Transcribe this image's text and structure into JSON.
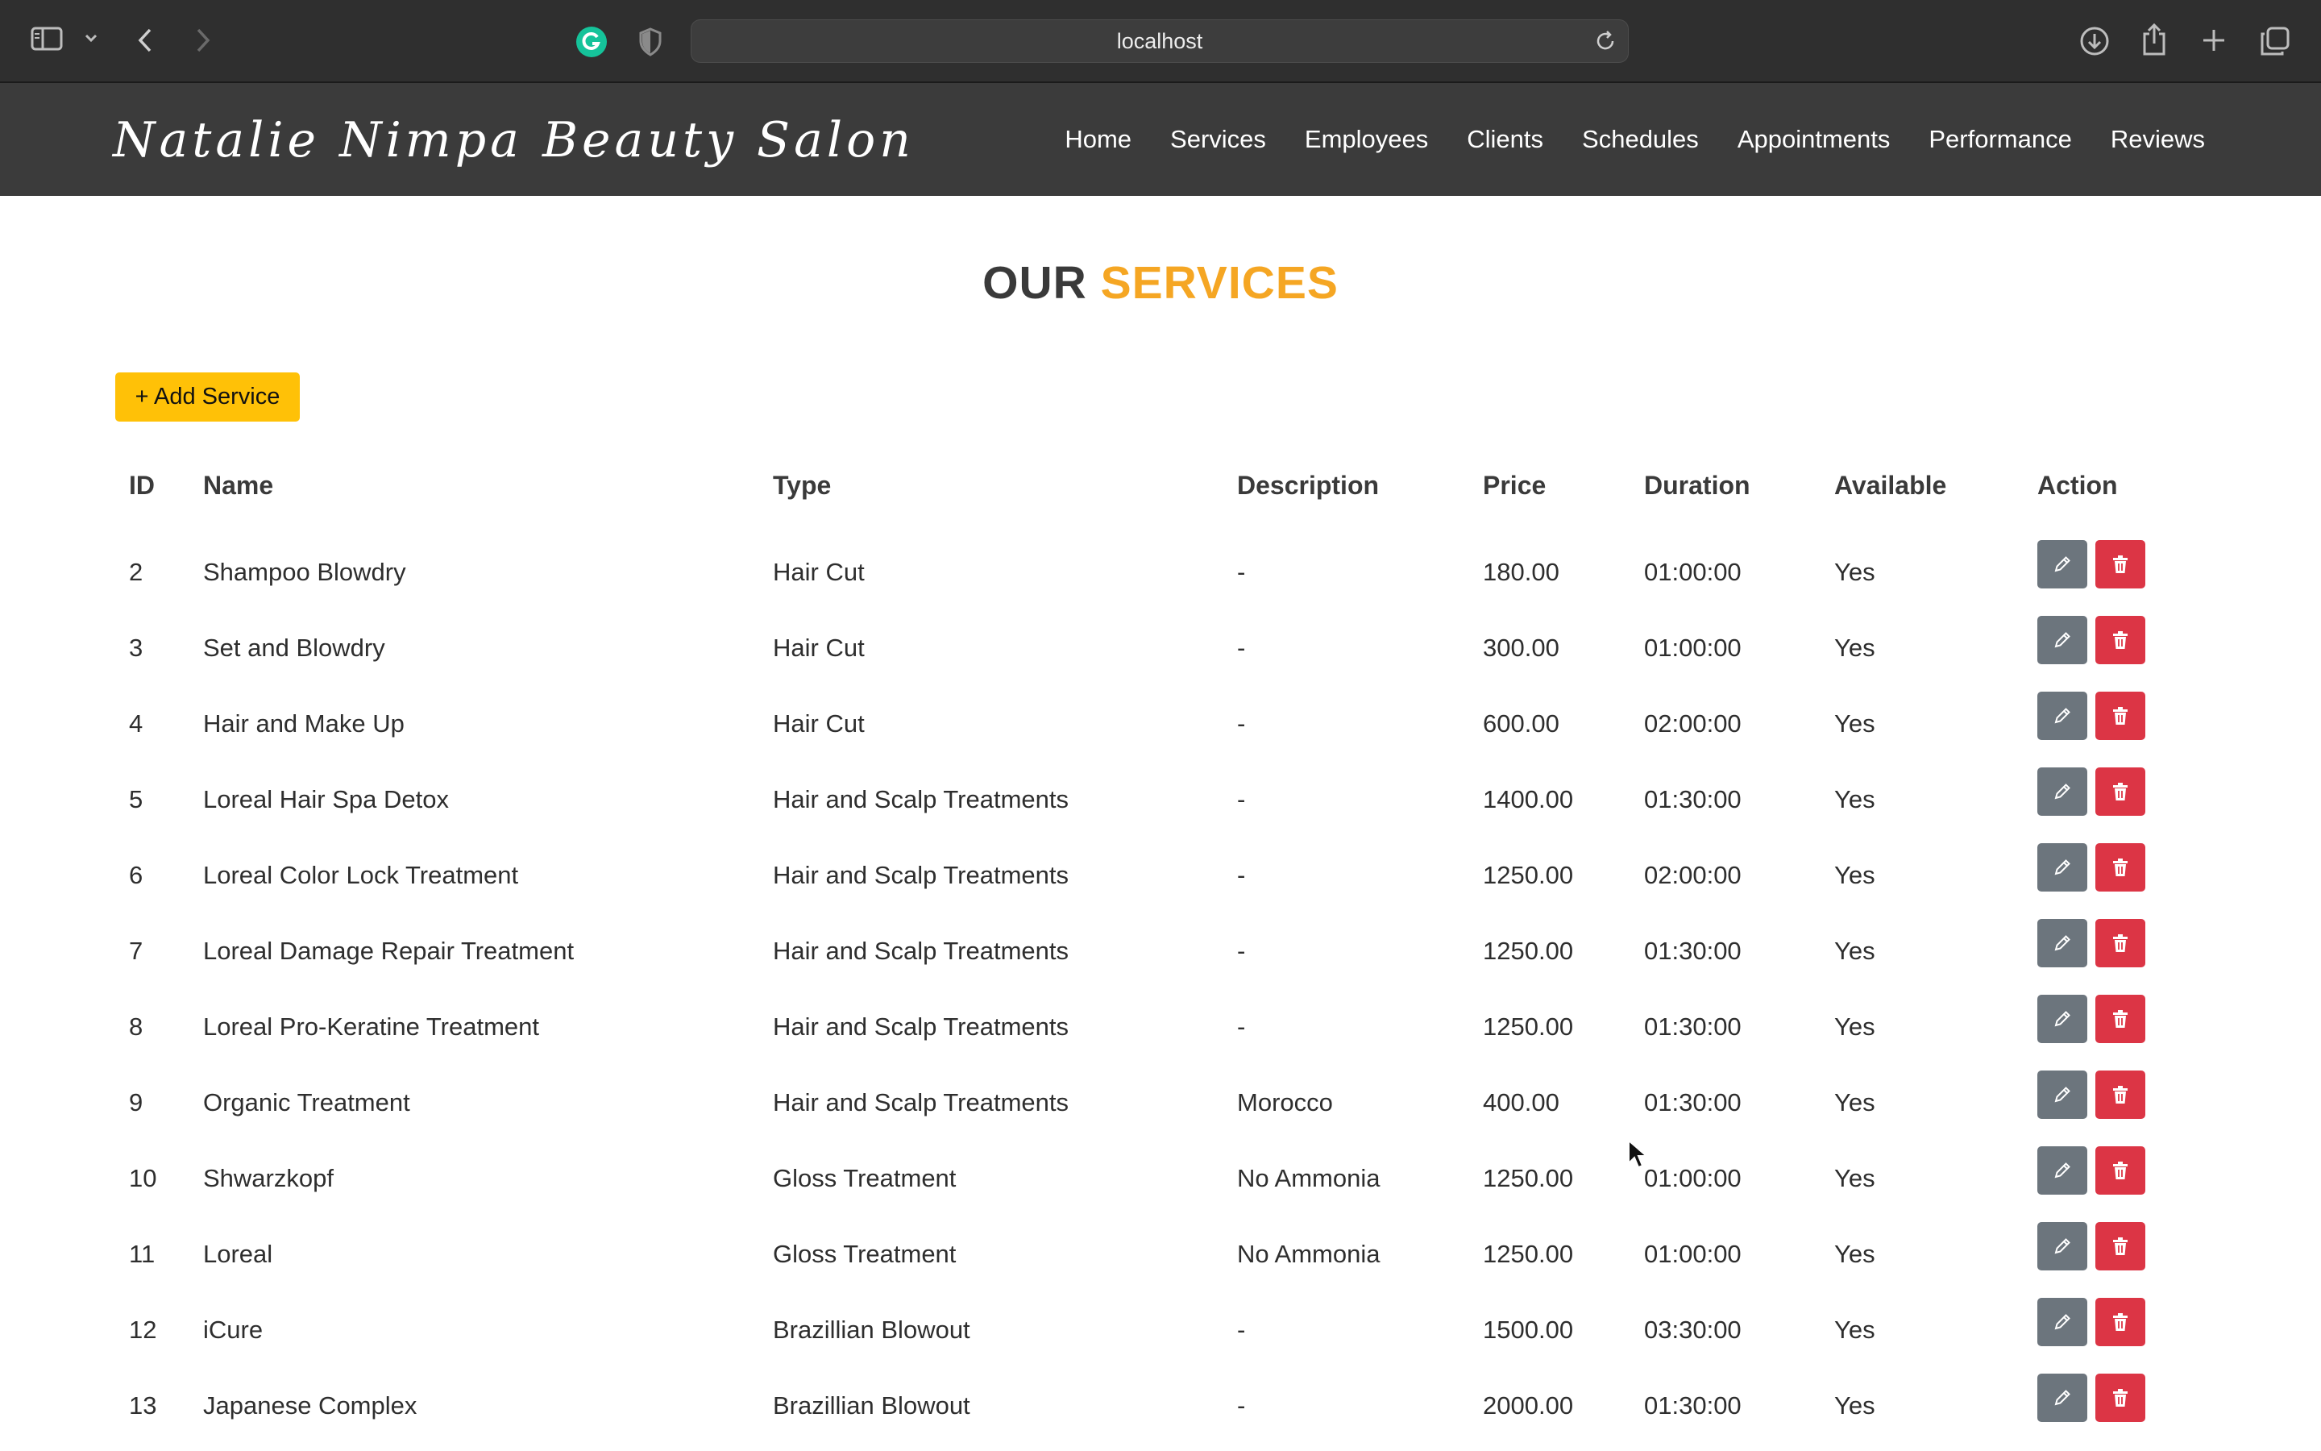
{
  "browser": {
    "url": "localhost"
  },
  "site": {
    "brand": "Natalie Nimpa Beauty Salon",
    "nav": [
      "Home",
      "Services",
      "Employees",
      "Clients",
      "Schedules",
      "Appointments",
      "Performance",
      "Reviews"
    ]
  },
  "page": {
    "heading_part1": "OUR",
    "heading_part2": "SERVICES",
    "add_button": "+ Add Service"
  },
  "table": {
    "headers": {
      "id": "ID",
      "name": "Name",
      "type": "Type",
      "description": "Description",
      "price": "Price",
      "duration": "Duration",
      "available": "Available",
      "action": "Action"
    },
    "rows": [
      {
        "id": "2",
        "name": "Shampoo Blowdry",
        "type": "Hair Cut",
        "description": "-",
        "price": "180.00",
        "duration": "01:00:00",
        "available": "Yes"
      },
      {
        "id": "3",
        "name": "Set and Blowdry",
        "type": "Hair Cut",
        "description": "-",
        "price": "300.00",
        "duration": "01:00:00",
        "available": "Yes"
      },
      {
        "id": "4",
        "name": "Hair and Make Up",
        "type": "Hair Cut",
        "description": "-",
        "price": "600.00",
        "duration": "02:00:00",
        "available": "Yes"
      },
      {
        "id": "5",
        "name": "Loreal Hair Spa Detox",
        "type": "Hair and Scalp Treatments",
        "description": "-",
        "price": "1400.00",
        "duration": "01:30:00",
        "available": "Yes"
      },
      {
        "id": "6",
        "name": "Loreal Color Lock Treatment",
        "type": "Hair and Scalp Treatments",
        "description": "-",
        "price": "1250.00",
        "duration": "02:00:00",
        "available": "Yes"
      },
      {
        "id": "7",
        "name": "Loreal Damage Repair Treatment",
        "type": "Hair and Scalp Treatments",
        "description": "-",
        "price": "1250.00",
        "duration": "01:30:00",
        "available": "Yes"
      },
      {
        "id": "8",
        "name": "Loreal Pro-Keratine Treatment",
        "type": "Hair and Scalp Treatments",
        "description": "-",
        "price": "1250.00",
        "duration": "01:30:00",
        "available": "Yes"
      },
      {
        "id": "9",
        "name": "Organic Treatment",
        "type": "Hair and Scalp Treatments",
        "description": "Morocco",
        "price": "400.00",
        "duration": "01:30:00",
        "available": "Yes"
      },
      {
        "id": "10",
        "name": "Shwarzkopf",
        "type": "Gloss Treatment",
        "description": "No Ammonia",
        "price": "1250.00",
        "duration": "01:00:00",
        "available": "Yes"
      },
      {
        "id": "11",
        "name": "Loreal",
        "type": "Gloss Treatment",
        "description": "No Ammonia",
        "price": "1250.00",
        "duration": "01:00:00",
        "available": "Yes"
      },
      {
        "id": "12",
        "name": "iCure",
        "type": "Brazillian Blowout",
        "description": "-",
        "price": "1500.00",
        "duration": "03:30:00",
        "available": "Yes"
      },
      {
        "id": "13",
        "name": "Japanese Complex",
        "type": "Brazillian Blowout",
        "description": "-",
        "price": "2000.00",
        "duration": "01:30:00",
        "available": "Yes"
      }
    ]
  },
  "colors": {
    "navbar": "#3b3b3b",
    "accent": "#f5a623",
    "add_button": "#ffc107",
    "edit_button": "#6c757d",
    "delete_button": "#dc3545"
  },
  "icons": {
    "edit": "pencil-icon",
    "delete": "trash-icon"
  }
}
